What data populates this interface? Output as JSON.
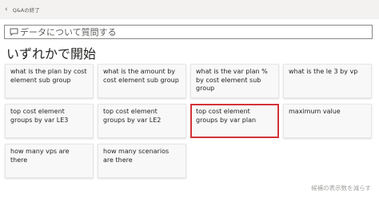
{
  "header": {
    "back_label": "Q&Aの終了"
  },
  "search": {
    "placeholder": "データについて質問する"
  },
  "heading": "いずれかで開始",
  "suggestions": [
    {
      "label": "what is the plan by cost element sub group"
    },
    {
      "label": "what is the amount by cost element sub group"
    },
    {
      "label": "what is the var plan % by cost element sub group"
    },
    {
      "label": "what is the le 3 by vp"
    },
    {
      "label": "top cost element groups by var LE3"
    },
    {
      "label": "top cost element groups by var LE2"
    },
    {
      "label": "top cost element groups by var plan"
    },
    {
      "label": "maximum value"
    },
    {
      "label": "how many vps are there"
    },
    {
      "label": "how many scenarios are there"
    }
  ],
  "footer": {
    "show_fewer_label": "候補の表示数を減らす"
  },
  "colors": {
    "selected_border": "#d13438",
    "card_bg": "#f8f8f8",
    "topbar_bg": "#f3f2f1"
  },
  "icons": {
    "back": "chevron-left-icon",
    "search": "chat-question-icon"
  }
}
